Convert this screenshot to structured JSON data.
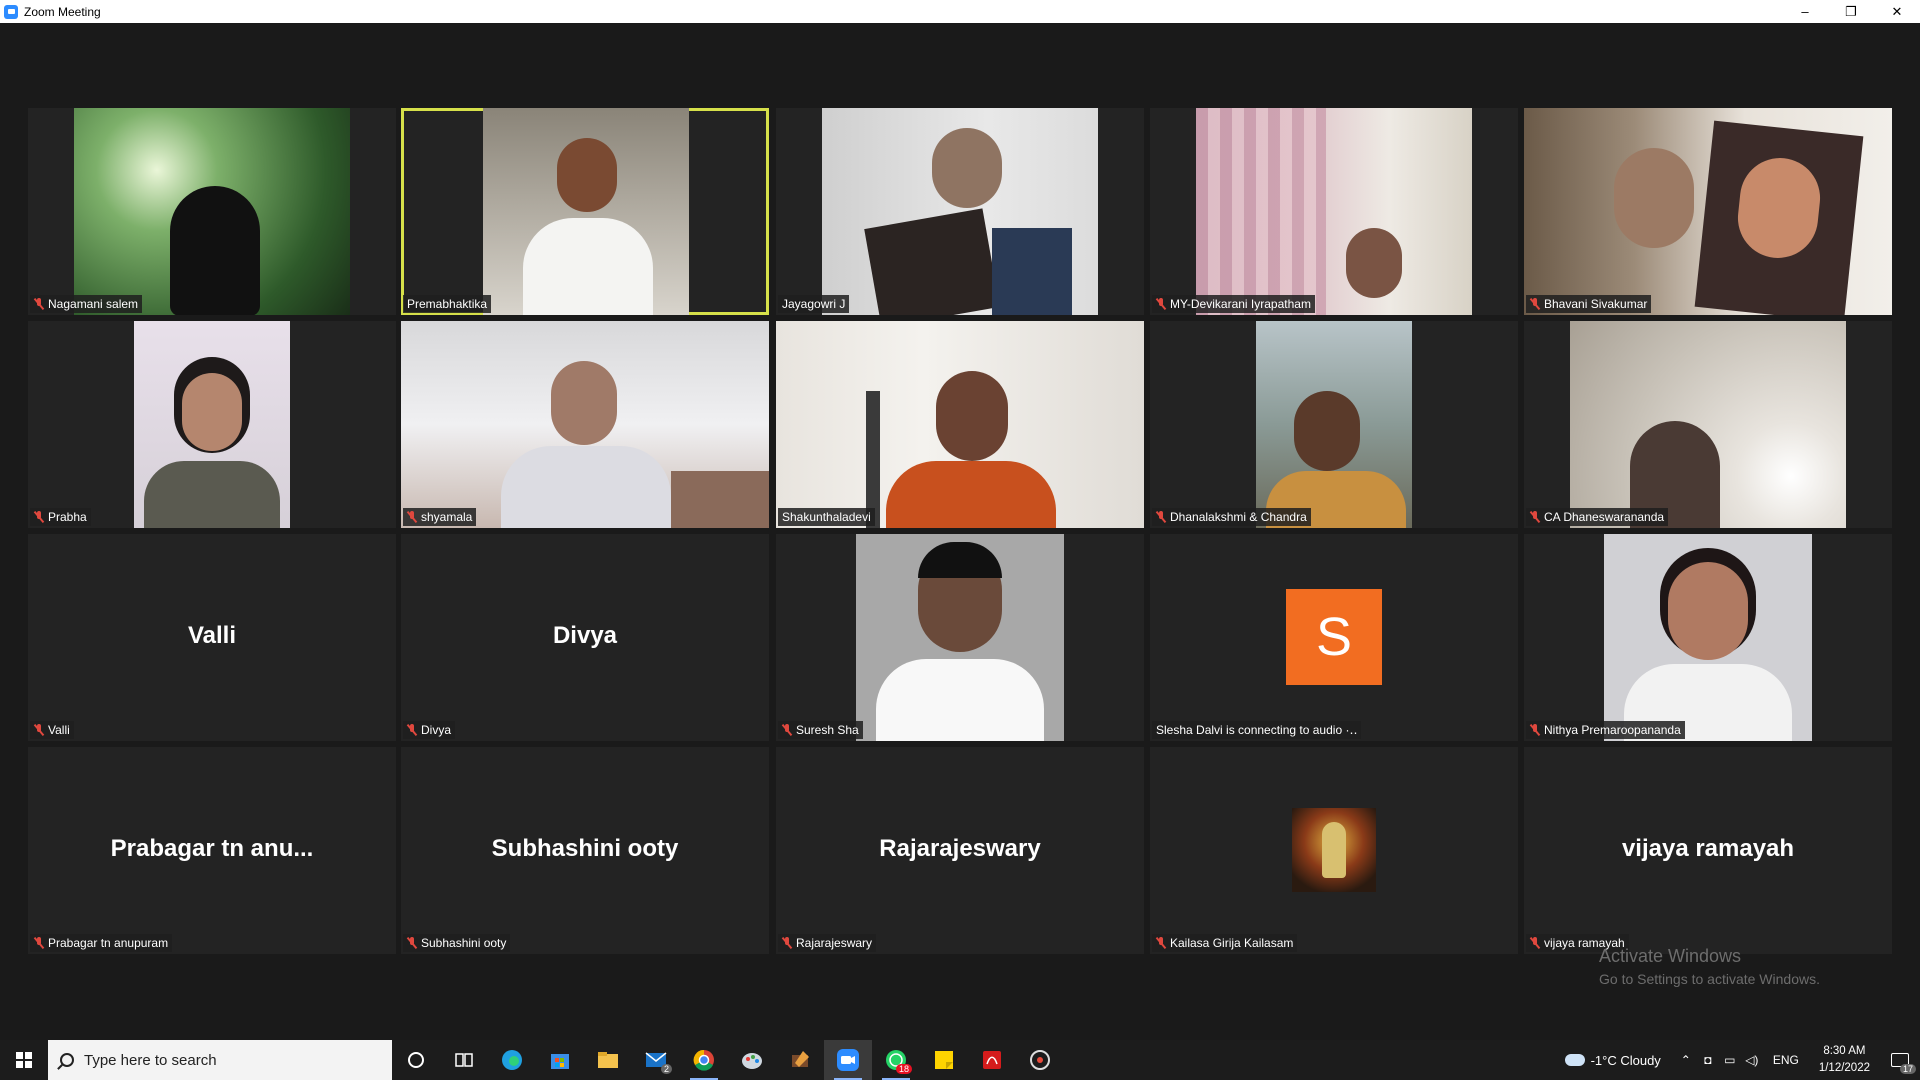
{
  "window": {
    "title": "Zoom Meeting",
    "controls": [
      "–",
      "❐",
      "✕"
    ]
  },
  "participants": [
    {
      "name": "Nagamani salem",
      "muted": true,
      "view": "video"
    },
    {
      "name": "Premabhaktika",
      "muted": false,
      "view": "video",
      "active_speaker": true
    },
    {
      "name": "Jayagowri J",
      "muted": false,
      "view": "video"
    },
    {
      "name": "MY-Devikarani Iyrapatham",
      "muted": true,
      "view": "video"
    },
    {
      "name": "Bhavani Sivakumar",
      "muted": true,
      "view": "video"
    },
    {
      "name": "Prabha",
      "muted": true,
      "view": "video"
    },
    {
      "name": "shyamala",
      "muted": true,
      "view": "video"
    },
    {
      "name": "Shakunthaladevi",
      "muted": false,
      "view": "video"
    },
    {
      "name": "Dhanalakshmi  & Chandra",
      "muted": true,
      "view": "video"
    },
    {
      "name": "CA Dhaneswarananda",
      "muted": true,
      "view": "video"
    },
    {
      "name": "Valli",
      "display": "Valli",
      "muted": true,
      "view": "name"
    },
    {
      "name": "Divya",
      "display": "Divya",
      "muted": true,
      "view": "name"
    },
    {
      "name": "Suresh Sha",
      "muted": true,
      "view": "video"
    },
    {
      "name": "Slesha Dalvi is connecting to audio ·‥",
      "avatar_letter": "S",
      "muted": false,
      "view": "avatar"
    },
    {
      "name": "Nithya Premaroopananda",
      "muted": true,
      "view": "video"
    },
    {
      "name": "Prabagar tn anupuram",
      "display": "Prabagar  tn  anu...",
      "muted": true,
      "view": "name"
    },
    {
      "name": "Subhashini ooty",
      "display": "Subhashini ooty",
      "muted": true,
      "view": "name"
    },
    {
      "name": "Rajarajeswary",
      "display": "Rajarajeswary",
      "muted": true,
      "view": "name"
    },
    {
      "name": "Kailasa Girija Kailasam",
      "muted": true,
      "view": "picture"
    },
    {
      "name": "vijaya ramayah",
      "display": "vijaya ramayah",
      "muted": true,
      "view": "name"
    }
  ],
  "watermark": {
    "line1": "Activate Windows",
    "line2": "Go to Settings to activate Windows."
  },
  "taskbar": {
    "search_placeholder": "Type here to search",
    "mail_badge": "2",
    "whatsapp_badge": "18",
    "weather": "-1°C  Cloudy",
    "language": "ENG",
    "time": "8:30 AM",
    "date": "1/12/2022",
    "notification_count": "17"
  }
}
